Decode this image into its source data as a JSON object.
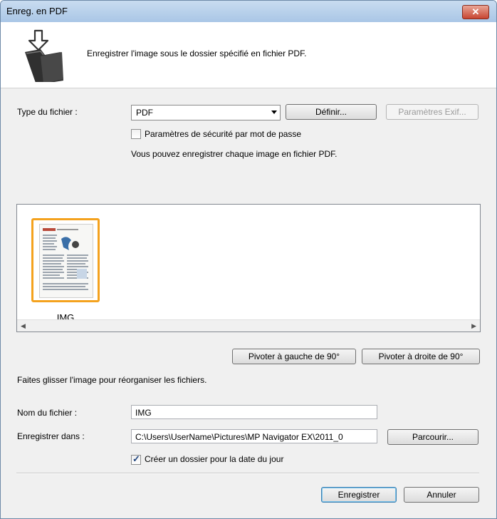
{
  "window": {
    "title": "Enreg. en PDF",
    "close_icon": "✕"
  },
  "header": {
    "description": "Enregistrer l'image sous le dossier spécifié en fichier PDF.",
    "icon": "save-folder-icon"
  },
  "file_type": {
    "label": "Type du fichier :",
    "value": "PDF",
    "define_button": "Définir...",
    "exif_button": "Paramètres Exif..."
  },
  "security": {
    "label": "Paramètres de sécurité par mot de passe",
    "checked": false
  },
  "info_text": "Vous pouvez enregistrer chaque image en fichier PDF.",
  "thumbnails": [
    {
      "caption": "IMG"
    }
  ],
  "rotate": {
    "left_button": "Pivoter à gauche de 90°",
    "right_button": "Pivoter à droite de 90°"
  },
  "drag_hint": "Faites glisser l'image pour réorganiser les fichiers.",
  "filename": {
    "label": "Nom du fichier :",
    "value": "IMG"
  },
  "save_in": {
    "label": "Enregistrer dans :",
    "value": "C:\\Users\\UserName\\Pictures\\MP Navigator EX\\2011_0",
    "browse_button": "Parcourir..."
  },
  "date_folder": {
    "label": "Créer un dossier pour la date du jour",
    "checked": true
  },
  "footer": {
    "save_button": "Enregistrer",
    "cancel_button": "Annuler"
  },
  "colors": {
    "selection": "#f4a21e",
    "titlebar": "#a9c6e6",
    "close": "#c74532"
  }
}
